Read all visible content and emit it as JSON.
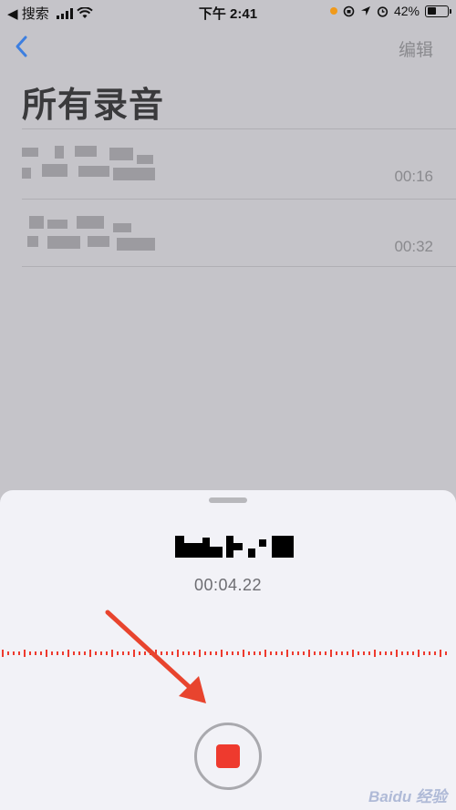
{
  "status_bar": {
    "back_app": "◀ 搜索",
    "time": "下午 2:41",
    "battery_percent": "42%"
  },
  "nav": {
    "edit_label": "编辑",
    "title": "所有录音"
  },
  "recordings": [
    {
      "duration": "00:16"
    },
    {
      "duration": "00:32"
    }
  ],
  "recording_sheet": {
    "timer": "00:04.22",
    "record_button_state": "recording"
  },
  "watermark": "Baidu 经验",
  "colors": {
    "record_red": "#ee3a2e",
    "annotation_arrow": "#e8442e",
    "accent_blue": "#3d7fe0"
  }
}
